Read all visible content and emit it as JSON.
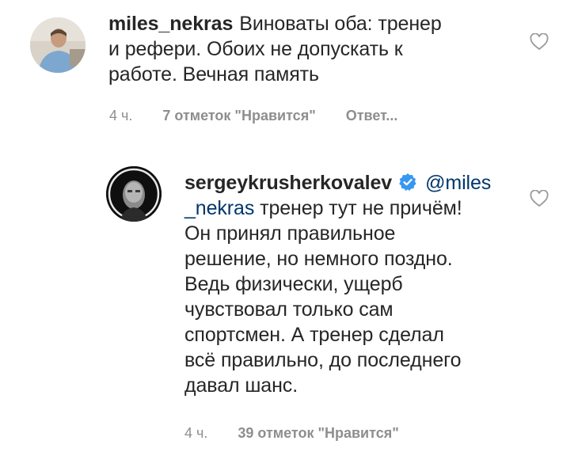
{
  "comments": [
    {
      "username": "miles_nekras",
      "text": "Виноваты оба: тренер и рефери. Обоих не допускать к работе. Вечная память",
      "lines": [
        "Виноваты оба: тренер",
        "и рефери. Обоих не допускать к",
        "работе. Вечная память"
      ],
      "time": "4 ч.",
      "likes": "7 отметок \"Нравится\"",
      "reply": "Ответ..."
    },
    {
      "username": "sergeykrusherkovalev",
      "verified": true,
      "mention_line1": "@miles",
      "mention_line2": "_nekras",
      "line2_rest": " тренер тут не причём!",
      "lines": [
        "Он принял правильное",
        "решение, но немного поздно.",
        "Ведь физически, ущерб",
        "чувствовал только сам",
        "спортсмен. А тренер сделал",
        "всё правильно, до последнего",
        "давал шанс."
      ],
      "time": "4 ч.",
      "likes": "39 отметок \"Нравится\""
    }
  ],
  "icons": {
    "like": "heart-outline-icon",
    "verified": "verified-badge-icon"
  },
  "colors": {
    "text": "#262626",
    "meta": "#8e8e8e",
    "mention": "#00376b",
    "verified": "#3897f0"
  }
}
